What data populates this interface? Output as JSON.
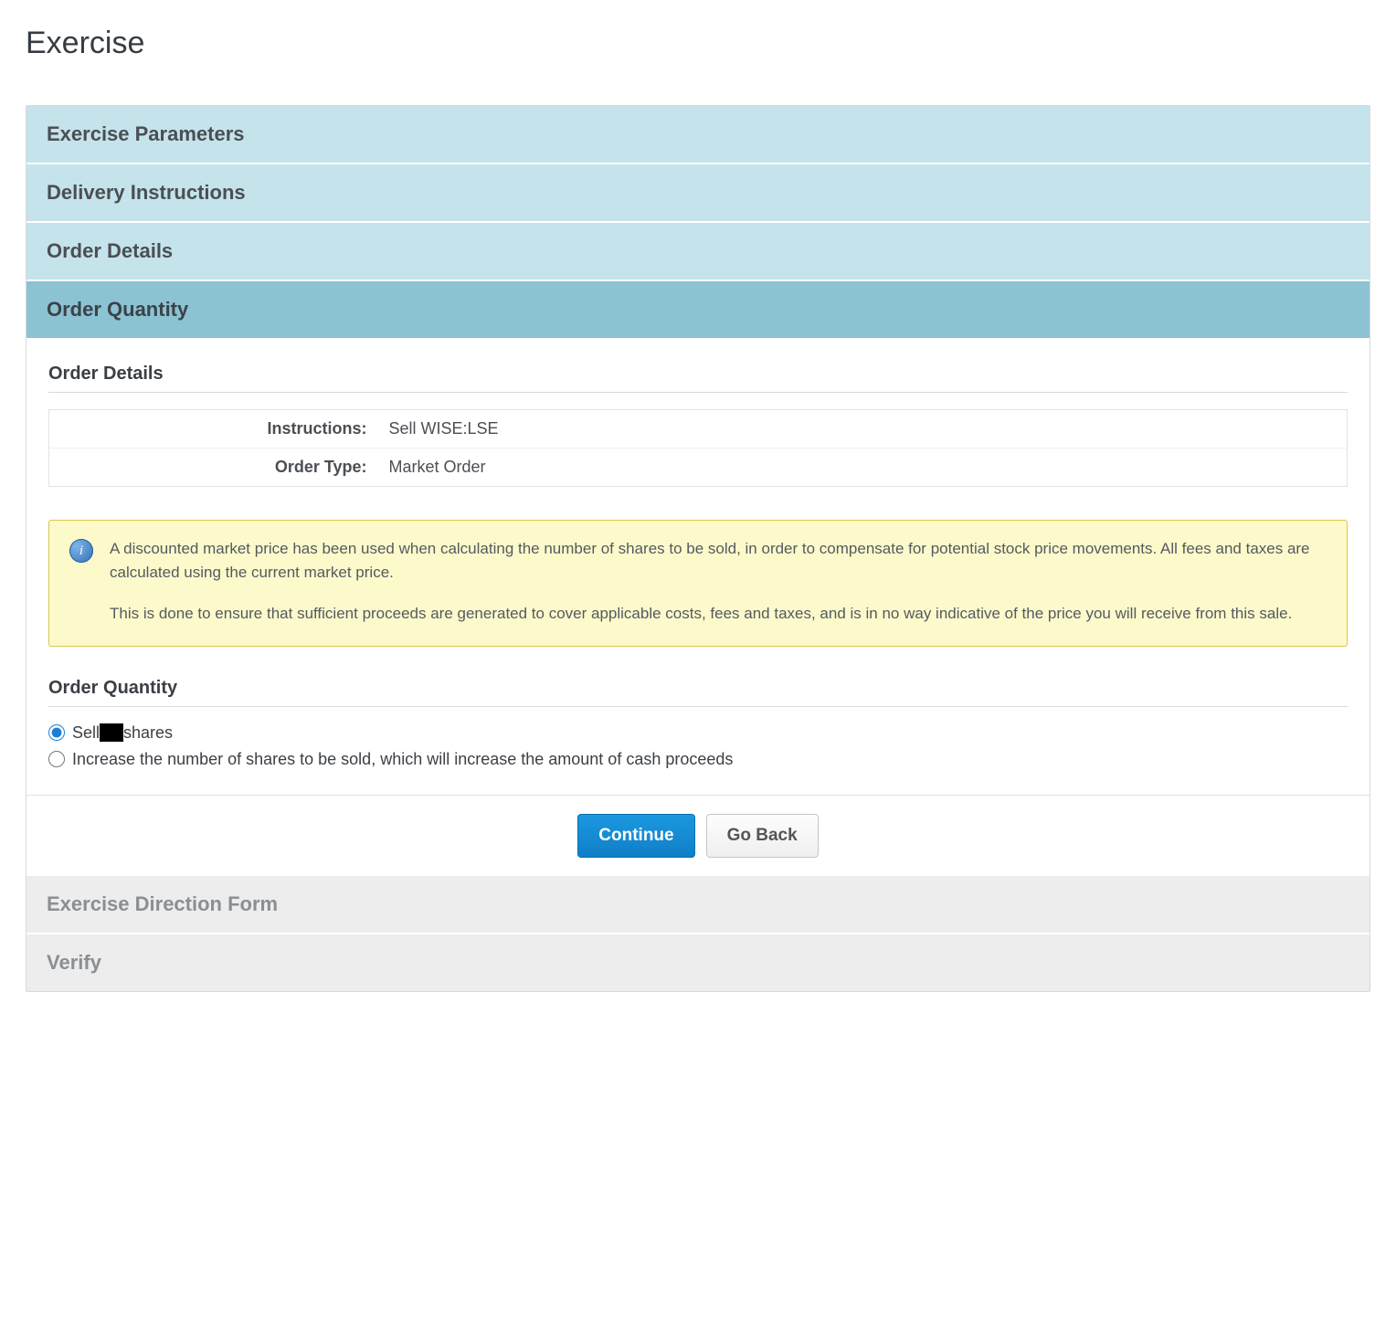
{
  "page": {
    "title": "Exercise"
  },
  "accordion": {
    "exercise_parameters": "Exercise Parameters",
    "delivery_instructions": "Delivery Instructions",
    "order_details": "Order Details",
    "order_quantity": "Order Quantity",
    "exercise_direction_form": "Exercise Direction Form",
    "verify": "Verify"
  },
  "order_details": {
    "section_title": "Order Details",
    "instructions_label": "Instructions:",
    "instructions_value": "Sell WISE:LSE",
    "order_type_label": "Order Type:",
    "order_type_value": "Market Order"
  },
  "info": {
    "para1": "A discounted market price has been used when calculating the number of shares to be sold, in order to compensate for potential stock price movements. All fees and taxes are calculated using the current market price.",
    "para2": "This is done to ensure that sufficient proceeds are generated to cover applicable costs, fees and taxes, and is in no way indicative of the price you will receive from this sale."
  },
  "order_quantity": {
    "section_title": "Order Quantity",
    "opt1_prefix": "Sell",
    "opt1_suffix": "shares",
    "opt2": "Increase the number of shares to be sold, which will increase the amount of cash proceeds"
  },
  "buttons": {
    "continue": "Continue",
    "go_back": "Go Back"
  }
}
